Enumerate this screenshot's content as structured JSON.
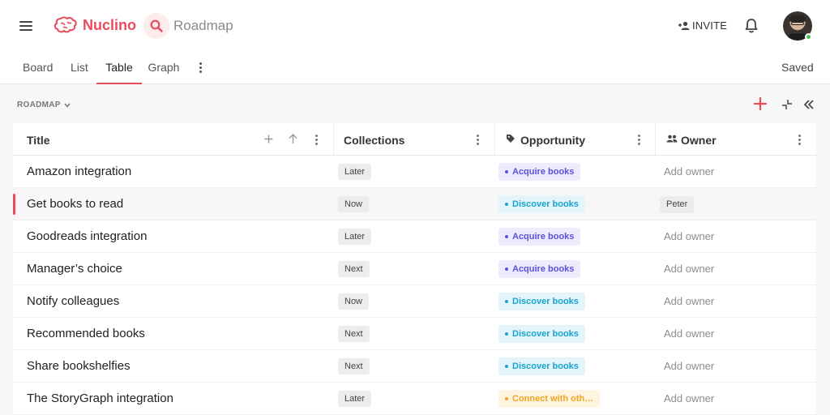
{
  "app": {
    "name": "Nuclino",
    "workspace": "Roadmap",
    "brand_color": "#ea4b5a"
  },
  "header": {
    "invite_label": "INVITE",
    "saved_label": "Saved"
  },
  "tabs": [
    {
      "label": "Board"
    },
    {
      "label": "List"
    },
    {
      "label": "Table",
      "active": true
    },
    {
      "label": "Graph"
    }
  ],
  "breadcrumb": {
    "label": "ROADMAP"
  },
  "table": {
    "columns": [
      {
        "label": "Title"
      },
      {
        "label": "Collections"
      },
      {
        "label": "Opportunity",
        "icon": "tag-icon"
      },
      {
        "label": "Owner",
        "icon": "people-icon"
      }
    ],
    "rows": [
      {
        "title": "Amazon integration",
        "collection": "Later",
        "opportunity": "Acquire books",
        "owner": "Add owner"
      },
      {
        "title": "Get books to read",
        "collection": "Now",
        "opportunity": "Discover books",
        "owner": "Peter",
        "selected": true
      },
      {
        "title": "Goodreads integration",
        "collection": "Later",
        "opportunity": "Acquire books",
        "owner": "Add owner"
      },
      {
        "title": "Manager’s choice",
        "collection": "Next",
        "opportunity": "Acquire books",
        "owner": "Add owner"
      },
      {
        "title": "Notify colleagues",
        "collection": "Now",
        "opportunity": "Discover books",
        "owner": "Add owner"
      },
      {
        "title": "Recommended books",
        "collection": "Next",
        "opportunity": "Discover books",
        "owner": "Add owner"
      },
      {
        "title": "Share bookshelfies",
        "collection": "Next",
        "opportunity": "Discover books",
        "owner": "Add owner"
      },
      {
        "title": "The StoryGraph integration",
        "collection": "Later",
        "opportunity": "Connect with oth…",
        "owner": "Add owner"
      }
    ]
  },
  "opportunity_colors": {
    "Acquire books": {
      "bg": "#ecebfd",
      "fg": "#5b4fe0"
    },
    "Discover books": {
      "bg": "#e3f4fb",
      "fg": "#1aa3cf"
    },
    "Connect with oth…": {
      "bg": "#fff4e0",
      "fg": "#f0a520"
    }
  }
}
